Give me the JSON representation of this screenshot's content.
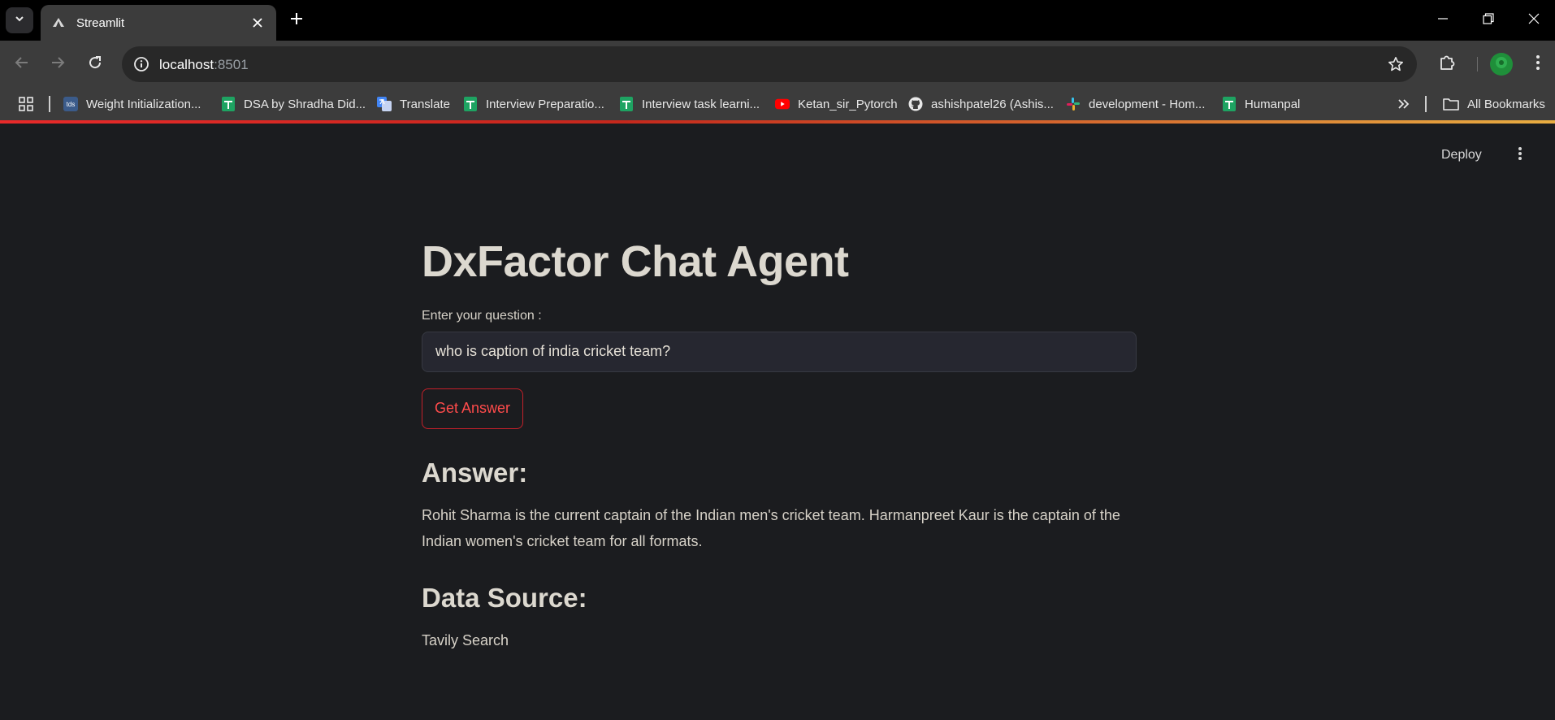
{
  "browser": {
    "tab": {
      "title": "Streamlit"
    },
    "url": {
      "host": "localhost",
      "port": ":8501"
    },
    "bookmarks": [
      {
        "label": "Weight Initialization...",
        "icon": "tds-icon"
      },
      {
        "label": "DSA by Shradha Did...",
        "icon": "sheets-icon"
      },
      {
        "label": "Translate",
        "icon": "translate-icon"
      },
      {
        "label": "Interview Preparatio...",
        "icon": "sheets-icon"
      },
      {
        "label": "Interview task learni...",
        "icon": "sheets-icon"
      },
      {
        "label": "Ketan_sir_Pytorch",
        "icon": "youtube-icon"
      },
      {
        "label": "ashishpatel26 (Ashis...",
        "icon": "github-icon"
      },
      {
        "label": "development - Hom...",
        "icon": "slack-icon"
      },
      {
        "label": "Humanpal",
        "icon": "sheets-icon"
      }
    ],
    "all_bookmarks": "All Bookmarks",
    "tds_icon_text": "tds"
  },
  "app": {
    "deploy_label": "Deploy",
    "title": "DxFactor Chat Agent",
    "question_label": "Enter your question :",
    "question_value": "who is caption of india cricket team?",
    "button_label": "Get Answer",
    "answer_heading": "Answer:",
    "answer_text": "Rohit Sharma is the current captain of the Indian men's cricket team. Harmanpreet Kaur is the captain of the Indian women's cricket team for all formats.",
    "source_heading": "Data Source:",
    "source_text": "Tavily Search"
  },
  "colors": {
    "background": "#1b1c1f",
    "accent": "#ff4b4b",
    "text": "#d7d2c8"
  }
}
